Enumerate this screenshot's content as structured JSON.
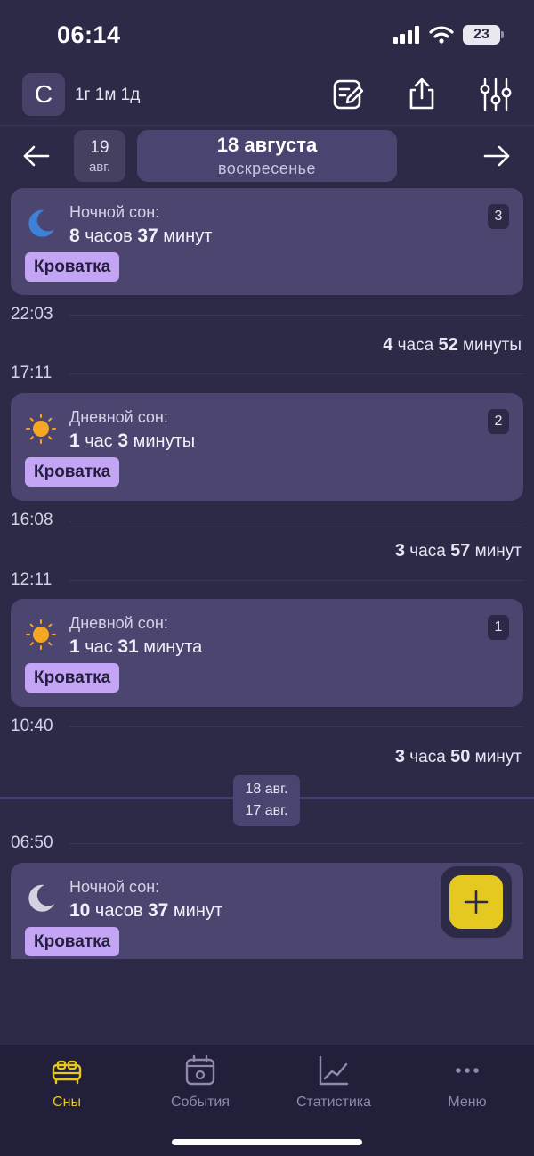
{
  "status_bar": {
    "time": "06:14",
    "battery": "23"
  },
  "header": {
    "avatar_letter": "С",
    "child_age": "1г 1м 1д"
  },
  "date_nav": {
    "prev_day": "19",
    "prev_month": "авг.",
    "current_date": "18 августа",
    "current_weekday": "воскресенье"
  },
  "cards": [
    {
      "type": "Ночной сон:",
      "d1": "8",
      "u1": "часов",
      "d2": "37",
      "u2": "минут",
      "tag": "Кроватка",
      "index": "3"
    },
    {
      "type": "Дневной сон:",
      "d1": "1",
      "u1": "час",
      "d2": "3",
      "u2": "минуты",
      "tag": "Кроватка",
      "index": "2"
    },
    {
      "type": "Дневной сон:",
      "d1": "1",
      "u1": "час",
      "d2": "31",
      "u2": "минута",
      "tag": "Кроватка",
      "index": "1"
    },
    {
      "type": "Ночной сон:",
      "d1": "10",
      "u1": "часов",
      "d2": "37",
      "u2": "минут",
      "tag": "Кроватка"
    }
  ],
  "times": [
    "22:03",
    "17:11",
    "16:08",
    "12:11",
    "10:40",
    "06:50"
  ],
  "gaps": [
    {
      "n1": "4",
      "u1": "часа",
      "n2": "52",
      "u2": "минуты"
    },
    {
      "n1": "3",
      "u1": "часа",
      "n2": "57",
      "u2": "минут"
    },
    {
      "n1": "3",
      "u1": "часа",
      "n2": "50",
      "u2": "минут"
    }
  ],
  "day_separator": {
    "upper": "18 авг.",
    "lower": "17 авг."
  },
  "tabs": [
    {
      "label": "Сны"
    },
    {
      "label": "События"
    },
    {
      "label": "Статистика"
    },
    {
      "label": "Меню"
    }
  ],
  "colors": {
    "accent": "#e5c820",
    "tag": "#c4a4f4",
    "card": "#4b4570",
    "background": "#2d2a48",
    "moon_active": "#3b82d8",
    "sun": "#f5a623"
  }
}
